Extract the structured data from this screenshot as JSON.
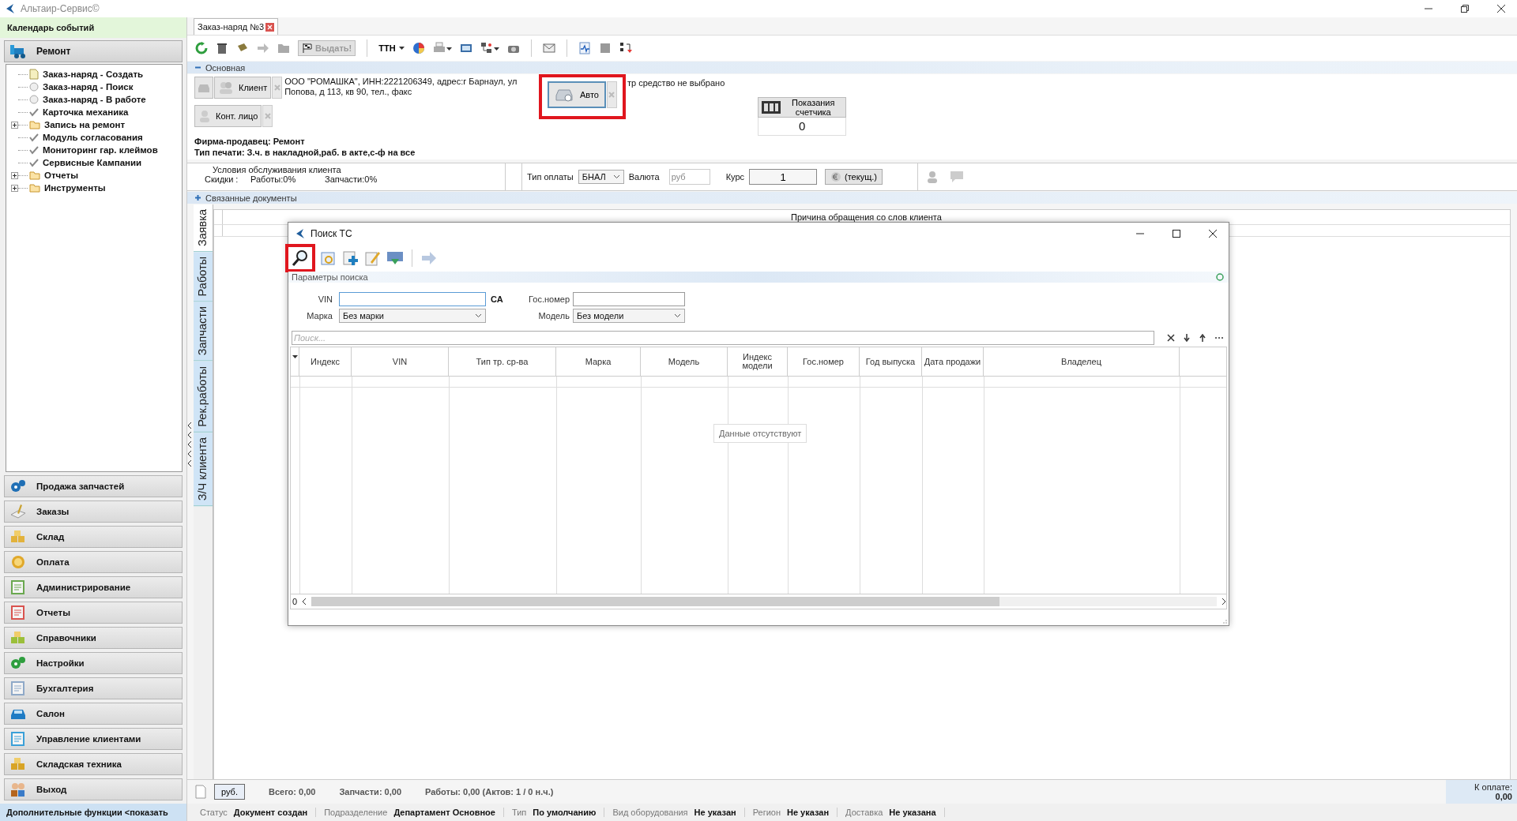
{
  "app": {
    "title": "Альтаир-Сервис©"
  },
  "sidebar": {
    "calendar": "Календарь событий",
    "section": "Ремонт",
    "tree": [
      {
        "label": "Заказ-наряд - Создать",
        "kind": "document"
      },
      {
        "label": "Заказ-наряд - Поиск",
        "kind": "circle"
      },
      {
        "label": "Заказ-наряд - В работе",
        "kind": "circle"
      },
      {
        "label": "Карточка механика",
        "kind": "check"
      },
      {
        "label": "Запись на ремонт",
        "kind": "folder"
      },
      {
        "label": "Модуль согласования",
        "kind": "check"
      },
      {
        "label": "Мониторинг гар. клеймов",
        "kind": "check"
      },
      {
        "label": "Сервисные Кампании",
        "kind": "check"
      },
      {
        "label": "Отчеты",
        "kind": "folder"
      },
      {
        "label": "Инструменты",
        "kind": "folder"
      }
    ],
    "modules": [
      "Продажа запчастей",
      "Заказы",
      "Склад",
      "Оплата",
      "Администрирование",
      "Отчеты",
      "Справочники",
      "Настройки",
      "Бухгалтерия",
      "Салон",
      "Управление клиентами",
      "Складская техника",
      "Выход"
    ],
    "footer": "Дополнительные функции <показать"
  },
  "document_tab": {
    "label": "Заказ-наряд №3"
  },
  "toolbar": {
    "issue_button": "Выдать!",
    "ttn_button": "ТТН"
  },
  "main_section": {
    "title": "Основная",
    "expanded": true,
    "client_button": "Клиент",
    "client_info": [
      "ООО \"РОМАШКА\", ИНН:2221206349, адрес:г Барнаул, ул",
      "Попова, д 113, кв 90, тел., факс"
    ],
    "vehicle_button": "Авто",
    "vehicle_info": "тр средство не выбрано",
    "contact_button": "Конт. лицо",
    "counter_label": "Показания счетчика",
    "counter_value": "0",
    "seller": "Фирма-продавец: Ремонт",
    "print_type": "Тип печати: З.ч. в накладной,раб. в акте,с-ф на все"
  },
  "conditions": {
    "title": "Условия обслуживания клиента",
    "discounts": "Скидки :",
    "works": "Работы:0%",
    "parts": "Запчасти:0%"
  },
  "payment": {
    "type_label": "Тип оплаты",
    "type_value": "БНАЛ",
    "currency_label": "Валюта",
    "currency_value": "руб",
    "rate_label": "Курс",
    "rate_value": "1",
    "rate_button": "(текущ.)"
  },
  "related_section": {
    "title": "Связанные документы",
    "expanded": false
  },
  "side_tabs": [
    {
      "label": "Заявка",
      "selected": true
    },
    {
      "label": "Работы",
      "selected": false
    },
    {
      "label": "Запчасти",
      "selected": false
    },
    {
      "label": "Рек.работы",
      "selected": false
    },
    {
      "label": "З/Ч клиента",
      "selected": false
    }
  ],
  "request_grid": {
    "columns": [
      "Причина обращения со слов клиента"
    ]
  },
  "dialog": {
    "title": "Поиск ТС",
    "params_title": "Параметры поиска",
    "vin_label": "VIN",
    "ca_label": "СА",
    "plate_label": "Гос.номер",
    "make_label": "Марка",
    "make_value": "Без марки",
    "model_label": "Модель",
    "model_value": "Без модели",
    "search_placeholder": "Поиск...",
    "columns": [
      "Индекс",
      "VIN",
      "Тип тр. ср-ва",
      "Марка",
      "Модель",
      "Индекс модели",
      "Гос.номер",
      "Год выпуска",
      "Дата продажи",
      "Владелец"
    ],
    "empty_text": "Данные отсутствуют",
    "row_count": "0"
  },
  "totals": {
    "currency": "руб.",
    "total": "Всего: 0,00",
    "parts": "Запчасти: 0,00",
    "works": "Работы: 0,00 (Актов: 1 / 0 н.ч.)",
    "to_pay_label": "К оплате:",
    "to_pay_value": "0,00"
  },
  "status_bar": [
    {
      "label": "Статус",
      "value": "Документ создан"
    },
    {
      "label": "Подразделение",
      "value": "Департамент Основное"
    },
    {
      "label": "Тип",
      "value": "По умолчанию"
    },
    {
      "label": "Вид оборудования",
      "value": "Не указан"
    },
    {
      "label": "Регион",
      "value": "Не указан"
    },
    {
      "label": "Доставка",
      "value": "Не указана"
    }
  ]
}
